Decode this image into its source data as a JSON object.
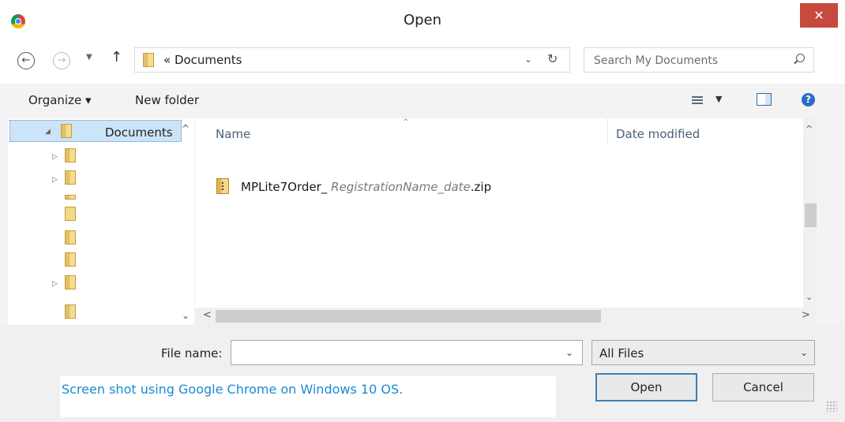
{
  "window": {
    "title": "Open",
    "close_glyph": "✕"
  },
  "address_bar": {
    "back_glyph": "←",
    "forward_glyph": "→",
    "recent_glyph": "▼",
    "up_glyph": "↑",
    "crumb": "« Documents",
    "dropdown_glyph": "⌄",
    "refresh_glyph": "↻",
    "search_placeholder": "Search My Documents"
  },
  "toolbar": {
    "organize": "Organize ▾",
    "new_folder": "New folder",
    "view_drop": "▼",
    "help": "?"
  },
  "nav_pane": {
    "selected_label": "Documents",
    "expand_glyph": "◢",
    "collapsed_glyph": "▷",
    "scroll_up": "^",
    "scroll_down": "⌄"
  },
  "file_list": {
    "columns": [
      "Name",
      "Date modified"
    ],
    "sort_glyph": "^",
    "rows": [
      {
        "name_prefix": "MPLite7Order_",
        "name_italic": " RegistrationName_date",
        "name_suffix": ".zip"
      }
    ],
    "scroll_up": "^",
    "scroll_down": "⌄",
    "scroll_left": "<",
    "scroll_right": ">"
  },
  "bottom": {
    "file_name_label": "File name:",
    "file_name_value": "",
    "file_name_drop": "⌄",
    "file_type": "All Files",
    "file_type_drop": "⌄",
    "open_button": "Open",
    "cancel_button": "Cancel"
  },
  "caption": "Screen shot using Google Chrome on Windows 10 OS."
}
